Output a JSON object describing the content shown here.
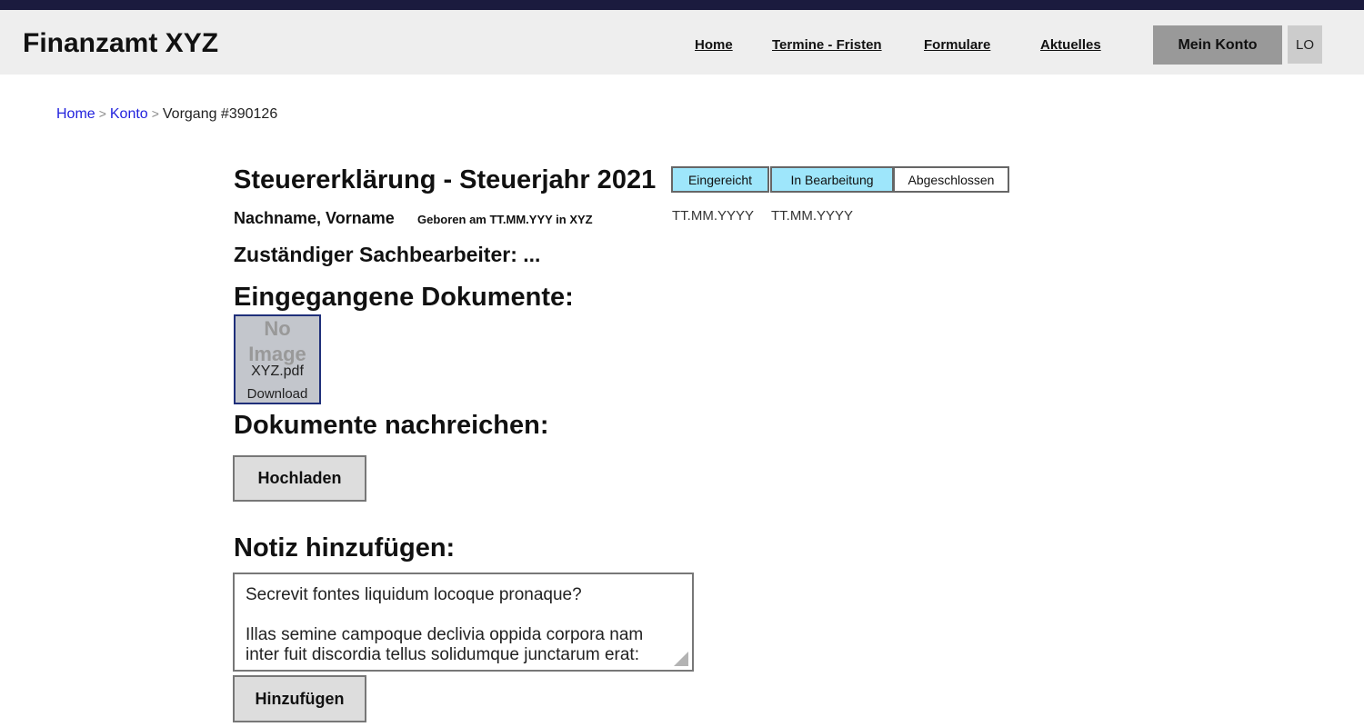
{
  "header": {
    "logo": "Finanzamt XYZ",
    "nav": [
      "Home",
      "Termine - Fristen",
      "Formulare",
      "Aktuelles"
    ],
    "account_button": "Mein Konto",
    "logout_button": "LO"
  },
  "breadcrumb": {
    "home": "Home",
    "separator": ">",
    "konto": "Konto",
    "current": "Vorgang #390126"
  },
  "case": {
    "title": "Steuererklärung - Steuerjahr 2021",
    "status_steps": [
      {
        "label": "Eingereicht",
        "active": true,
        "date": "TT.MM.YYYY"
      },
      {
        "label": "In Bearbeitung",
        "active": true,
        "date": "TT.MM.YYYY"
      },
      {
        "label": "Abgeschlossen",
        "active": false,
        "date": ""
      }
    ],
    "person_name": "Nachname, Vorname",
    "birth_info": "Geboren am TT.MM.YYY in XYZ",
    "case_worker": "Zuständiger Sachbearbeiter: ..."
  },
  "documents": {
    "heading": "Eingegangene Dokumente:",
    "items": [
      {
        "placeholder_line1": "No",
        "placeholder_line2": "Image",
        "file_name": "XYZ.pdf",
        "download_label": "Download"
      }
    ]
  },
  "upload": {
    "heading": "Dokumente nachreichen:",
    "button": "Hochladen"
  },
  "note": {
    "heading": "Notiz hinzufügen:",
    "textarea_lines": [
      "Secrevit fontes liquidum locoque pronaque?",
      "",
      "Illas semine campoque declivia oppida corpora nam",
      "inter fuit discordia tellus solidumque junctarum erat:"
    ],
    "button": "Hinzufügen"
  },
  "colors": {
    "top_strip": "#1b1b3e",
    "header_bg": "#eeeeee",
    "status_active": "#9ee6fb",
    "link": "#2222dd",
    "document_border": "#1f2f7a"
  }
}
